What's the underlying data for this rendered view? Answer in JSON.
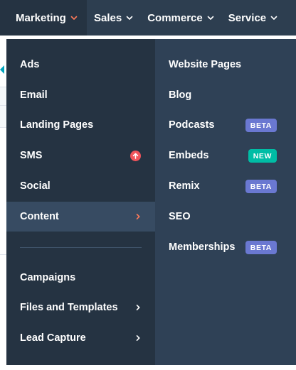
{
  "colors": {
    "topnav_bg": "#2d3e50",
    "menu_left_bg": "#253342",
    "menu_right_bg": "#2f4156",
    "highlight_bg": "#374b62",
    "accent_orange": "#ff7a59",
    "beta_badge": "#6a78d1",
    "new_badge": "#00bda5",
    "sms_alert": "#f2545b"
  },
  "topnav": {
    "items": [
      {
        "label": "Marketing",
        "icon": "chevron-down-icon",
        "active": true
      },
      {
        "label": "Sales",
        "icon": "chevron-down-icon"
      },
      {
        "label": "Commerce",
        "icon": "chevron-down-icon"
      },
      {
        "label": "Service",
        "icon": "chevron-down-icon"
      }
    ]
  },
  "menu": {
    "left": [
      {
        "label": "Ads"
      },
      {
        "label": "Email"
      },
      {
        "label": "Landing Pages"
      },
      {
        "label": "SMS",
        "icon": "upgrade-arrow-icon"
      },
      {
        "label": "Social"
      },
      {
        "label": "Content",
        "icon": "chevron-right-icon",
        "highlighted": true
      },
      {
        "label": "Campaigns"
      },
      {
        "label": "Files and Templates",
        "icon": "chevron-right-icon"
      },
      {
        "label": "Lead Capture",
        "icon": "chevron-right-icon"
      }
    ],
    "right": [
      {
        "label": "Website Pages"
      },
      {
        "label": "Blog"
      },
      {
        "label": "Podcasts",
        "badge": "BETA"
      },
      {
        "label": "Embeds",
        "badge": "NEW"
      },
      {
        "label": "Remix",
        "badge": "BETA"
      },
      {
        "label": "SEO"
      },
      {
        "label": "Memberships",
        "badge": "BETA"
      }
    ]
  }
}
